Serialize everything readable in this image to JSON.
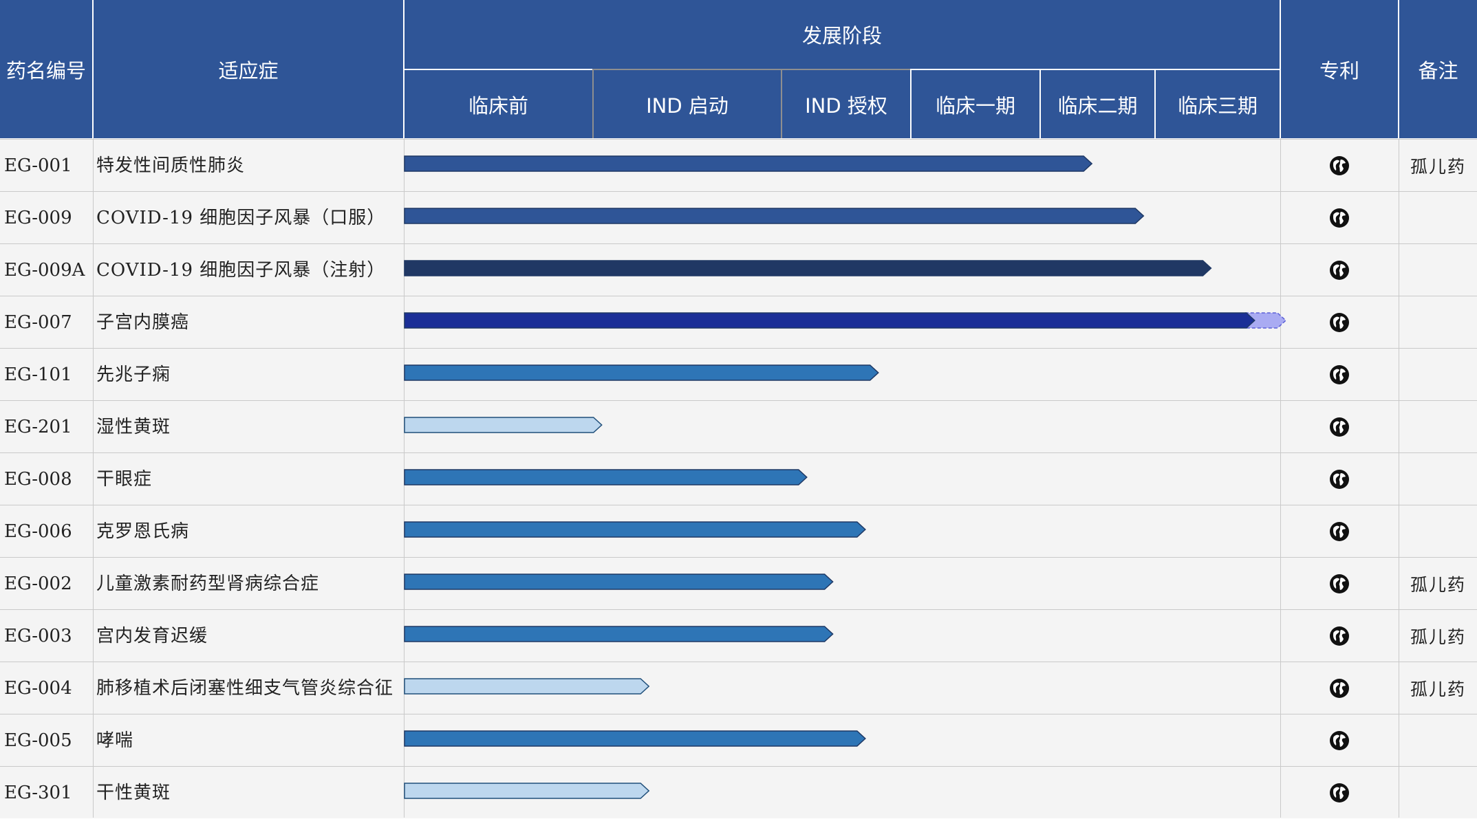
{
  "header": {
    "code_col": "药名编号",
    "indication_col": "适应症",
    "stage_group": "发展阶段",
    "patent_col": "专利",
    "note_col": "备注",
    "stages": [
      "临床前",
      "IND 启动",
      "IND 授权",
      "临床一期",
      "临床二期",
      "临床三期"
    ]
  },
  "colors": {
    "header_bg": "#2f5597",
    "row_bg": "#f4f4f4",
    "bar_medium": "#2e75b6",
    "bar_blue": "#2f5597",
    "bar_dark": "#203864",
    "bar_navy": "#1b2f97",
    "bar_light": "#bdd7ee",
    "bar_projected": "#a9abf2"
  },
  "rows": [
    {
      "code": "EG-001",
      "indication": "特发性间质性肺炎",
      "progress": 4.45,
      "color": "bar_blue",
      "patent_icon": "globe-icon",
      "note": "孤儿药"
    },
    {
      "code": "EG-009",
      "indication": "COVID-19 细胞因子风暴（口服）",
      "progress": 4.9,
      "color": "bar_blue",
      "patent_icon": "globe-icon",
      "note": ""
    },
    {
      "code": "EG-009A",
      "indication": "COVID-19 细胞因子风暴（注射）",
      "progress": 5.45,
      "color": "bar_dark",
      "patent_icon": "globe-icon",
      "note": ""
    },
    {
      "code": "EG-007",
      "indication": "子宫内膜癌",
      "progress": 5.8,
      "projected": 6.05,
      "color": "bar_navy",
      "patent_icon": "globe-icon",
      "note": ""
    },
    {
      "code": "EG-101",
      "indication": "先兆子痫",
      "progress": 2.75,
      "color": "bar_medium",
      "patent_icon": "globe-icon",
      "note": ""
    },
    {
      "code": "EG-201",
      "indication": "湿性黄斑",
      "progress": 1.05,
      "color": "bar_light",
      "patent_icon": "globe-icon",
      "note": ""
    },
    {
      "code": "EG-008",
      "indication": "干眼症",
      "progress": 2.2,
      "color": "bar_medium",
      "patent_icon": "globe-icon",
      "note": ""
    },
    {
      "code": "EG-006",
      "indication": "克罗恩氏病",
      "progress": 2.65,
      "color": "bar_medium",
      "patent_icon": "globe-icon",
      "note": ""
    },
    {
      "code": "EG-002",
      "indication": "儿童激素耐药型肾病综合症",
      "progress": 2.4,
      "color": "bar_medium",
      "patent_icon": "globe-icon",
      "note": "孤儿药"
    },
    {
      "code": "EG-003",
      "indication": "宫内发育迟缓",
      "progress": 2.4,
      "color": "bar_medium",
      "patent_icon": "globe-icon",
      "note": "孤儿药"
    },
    {
      "code": "EG-004",
      "indication": "肺移植术后闭塞性细支气管炎综合征",
      "progress": 1.3,
      "color": "bar_light",
      "patent_icon": "globe-icon",
      "note": "孤儿药"
    },
    {
      "code": "EG-005",
      "indication": "哮喘",
      "progress": 2.65,
      "color": "bar_medium",
      "patent_icon": "globe-icon",
      "note": ""
    },
    {
      "code": "EG-301",
      "indication": "干性黄斑",
      "progress": 1.3,
      "color": "bar_light",
      "patent_icon": "globe-icon",
      "note": ""
    }
  ]
}
